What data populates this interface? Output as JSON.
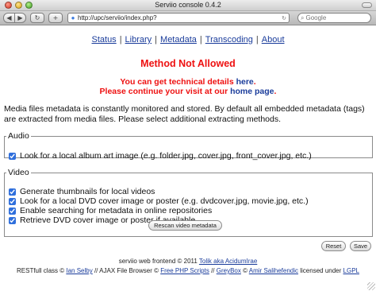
{
  "window": {
    "title": "Serviio console 0.4.2"
  },
  "toolbar": {
    "back_icon": "back-arrow",
    "forward_icon": "forward-arrow",
    "reload_icon": "reload",
    "add_icon": "plus",
    "url": "http://upc/serviio/index.php?",
    "search_placeholder": "Google"
  },
  "nav": {
    "items": [
      "Status",
      "Library",
      "Metadata",
      "Transcoding",
      "About"
    ],
    "separator": "|"
  },
  "error": {
    "title": "Method Not Allowed",
    "details_prefix": "You can get technical details ",
    "details_link": "here",
    "details_suffix": ".",
    "continue_prefix": "Please continue your visit at our ",
    "continue_link": "home page",
    "continue_suffix": "."
  },
  "description": "Media files metadata is constantly monitored and stored. By default all embedded metadata (tags) are extracted from media files. Please select additional extracting methods.",
  "audio": {
    "legend": "Audio",
    "options": [
      {
        "label": "Look for a local album art image (e.g. folder.jpg, cover.jpg, front_cover.jpg, etc.)",
        "checked": true
      }
    ]
  },
  "video": {
    "legend": "Video",
    "options": [
      {
        "label": "Generate thumbnails for local videos",
        "checked": true
      },
      {
        "label": "Look for a local DVD cover image or poster (e.g. dvdcover.jpg, movie.jpg, etc.)",
        "checked": true
      },
      {
        "label": "Enable searching for metadata in online repositories",
        "checked": true
      },
      {
        "label": "Retrieve DVD cover image or poster if available",
        "checked": true
      }
    ],
    "rescan_label": "Rescan video metadata"
  },
  "actions": {
    "reset_label": "Reset",
    "save_label": "Save"
  },
  "footer": {
    "line1_prefix": "serviio web frontend © 2011 ",
    "line1_link": "Tolik aka AcidumIrae",
    "line2": {
      "t1": "RESTfull class © ",
      "l1": "Ian Selby",
      "t2": " // AJAX File Browser © ",
      "l2": "Free PHP Scripts",
      "t3": " // ",
      "l3": "GreyBox",
      "t4": " © ",
      "l4": "Amir Salihefendic",
      "t5": " licensed under ",
      "l5": "LGPL"
    }
  },
  "colors": {
    "error_red": "#ee1111",
    "link_blue": "#1a3c9b"
  }
}
